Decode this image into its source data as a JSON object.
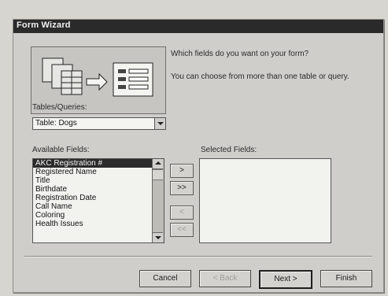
{
  "window": {
    "title": "Form Wizard"
  },
  "intro": {
    "question": "Which fields do you want on your form?",
    "hint": "You can choose from more than one table or query."
  },
  "tables": {
    "label": "Tables/Queries:",
    "selected": "Table: Dogs"
  },
  "available": {
    "label": "Available Fields:",
    "items": [
      "AKC Registration #",
      "Registered Name",
      "Title",
      "Birthdate",
      "Registration Date",
      "Call Name",
      "Coloring",
      "Health Issues"
    ]
  },
  "selected": {
    "label": "Selected Fields:",
    "items": []
  },
  "move_buttons": {
    "add_one": ">",
    "add_all": ">>",
    "remove_one": "<",
    "remove_all": "<<"
  },
  "buttons": {
    "cancel": "Cancel",
    "back": "< Back",
    "next": "Next >",
    "finish": "Finish"
  }
}
